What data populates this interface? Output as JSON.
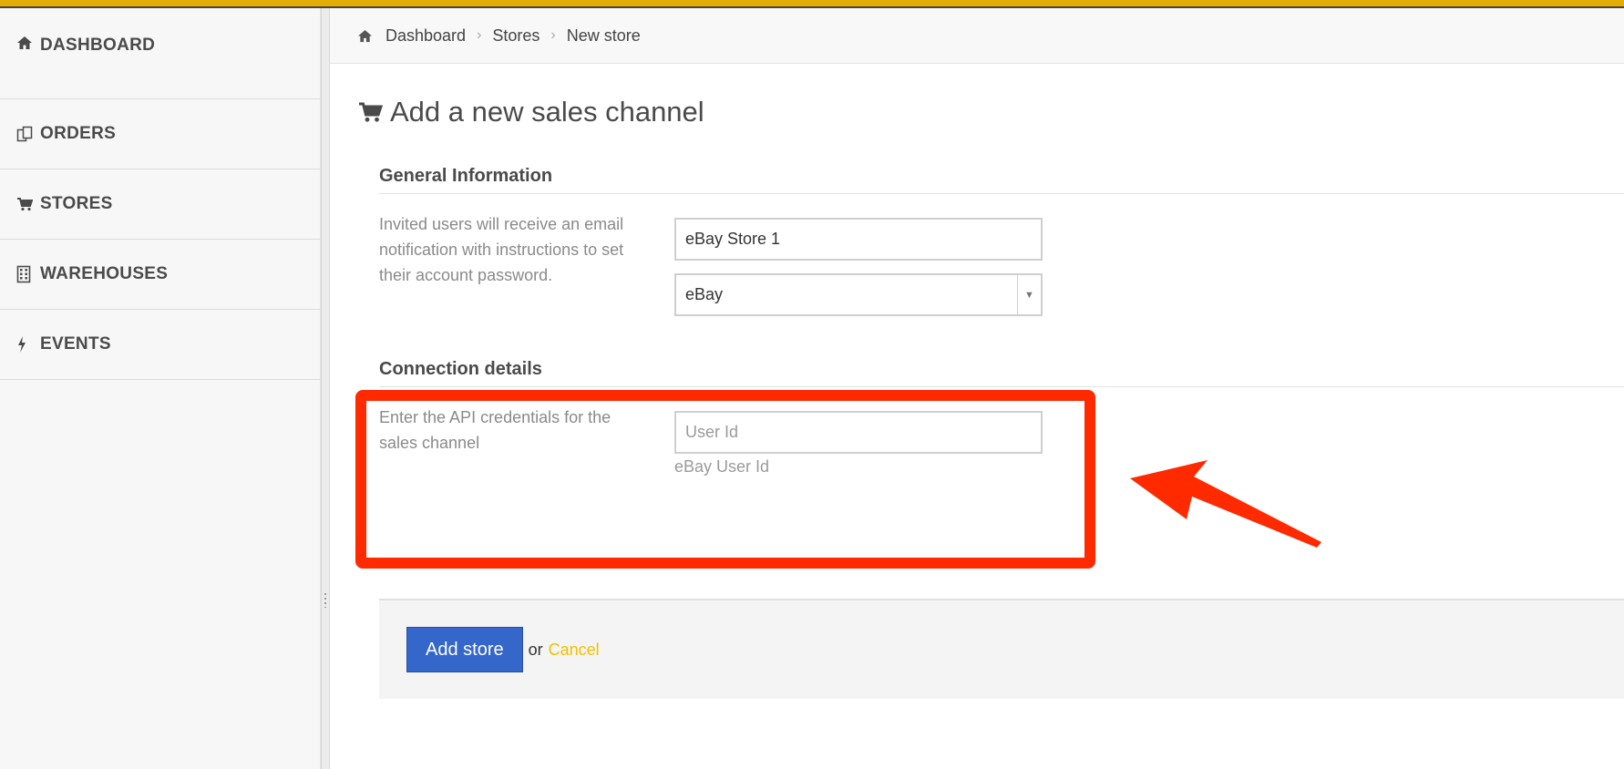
{
  "sidebar": {
    "items": [
      {
        "label": "DASHBOARD",
        "icon": "home-icon"
      },
      {
        "label": "ORDERS",
        "icon": "orders-icon"
      },
      {
        "label": "STORES",
        "icon": "cart-icon"
      },
      {
        "label": "WAREHOUSES",
        "icon": "building-icon"
      },
      {
        "label": "EVENTS",
        "icon": "bolt-icon"
      }
    ]
  },
  "breadcrumb": {
    "items": [
      "Dashboard",
      "Stores",
      "New store"
    ]
  },
  "page": {
    "title": "Add a new sales channel"
  },
  "general": {
    "title": "General Information",
    "description": "Invited users will receive an email notification with instructions to set their account password.",
    "store_name_value": "eBay Store 1",
    "channel_selected": "eBay"
  },
  "connection": {
    "title": "Connection details",
    "description": "Enter the API credentials for the sales channel",
    "user_id_placeholder": "User Id",
    "user_id_help": "eBay User Id"
  },
  "actions": {
    "add_label": "Add store",
    "or_text": "or",
    "cancel_label": "Cancel"
  },
  "colors": {
    "top_bar": "#e3ad06",
    "primary_button": "#3566c9",
    "cancel_link": "#f0c000",
    "annotation_red": "#ff2a00"
  }
}
